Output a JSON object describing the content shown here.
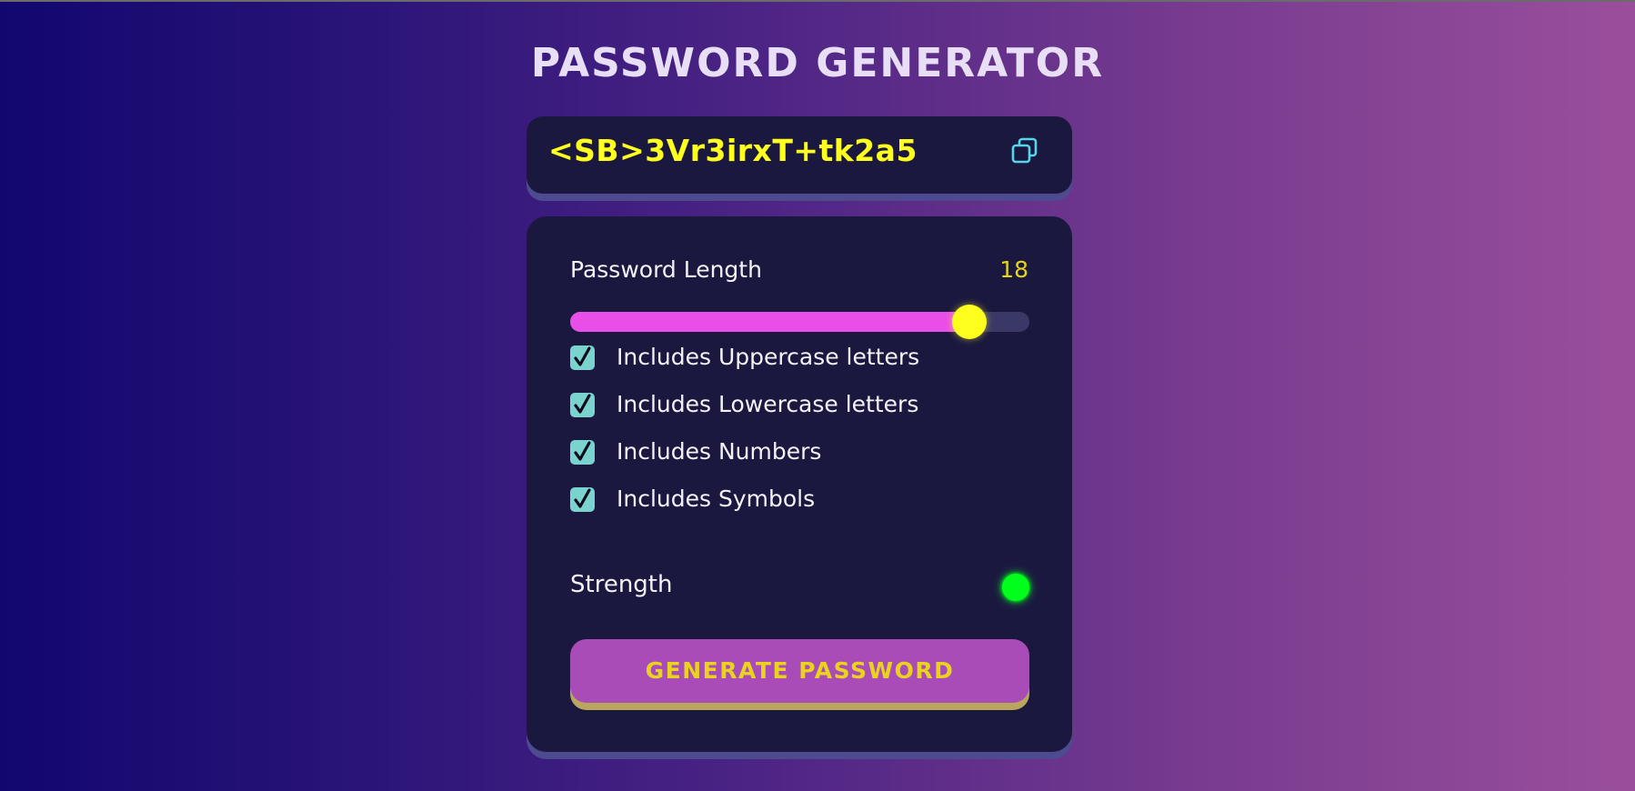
{
  "title": "PASSWORD GENERATOR",
  "display": {
    "password": "<SB>3Vr3irxT+tk2a5",
    "copy_icon": "copy-icon"
  },
  "length": {
    "label": "Password Length",
    "value": "18",
    "fill_fraction": 0.87
  },
  "options": [
    {
      "label": "Includes Uppercase letters",
      "checked": true
    },
    {
      "label": "Includes Lowercase letters",
      "checked": true
    },
    {
      "label": "Includes Numbers",
      "checked": true
    },
    {
      "label": "Includes Symbols",
      "checked": true
    }
  ],
  "strength": {
    "label": "Strength",
    "color": "#00ff1a"
  },
  "generate_label": "GENERATE PASSWORD",
  "colors": {
    "accent_yellow": "#ffff1e",
    "slider_pink": "#ea4ee8",
    "checkbox_teal": "#7ad3ce",
    "button_purple": "#aa4cb8",
    "panel": "#1b1840"
  }
}
